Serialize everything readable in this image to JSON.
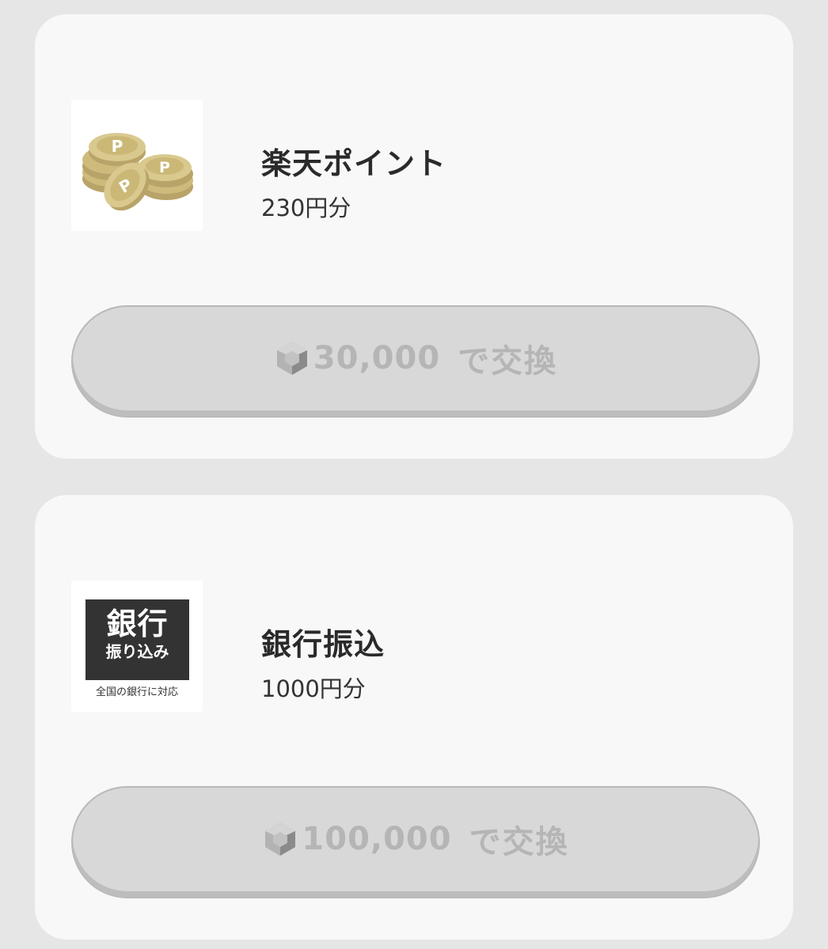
{
  "rewards": [
    {
      "title": "楽天ポイント",
      "amount": "230円分",
      "button": {
        "cost": "30,000",
        "suffix": "で交換"
      }
    },
    {
      "title": "銀行振込",
      "amount": "1000円分",
      "logo": {
        "main": "銀行",
        "sub": "振り込み",
        "note": "全国の銀行に対応"
      },
      "button": {
        "cost": "100,000",
        "suffix": "で交換"
      }
    }
  ],
  "icons": {
    "reward_1": "rakuten-point-coins-icon",
    "reward_2": "bank-transfer-logo",
    "currency": "gem-icon"
  },
  "colors": {
    "page_background": "#e6e6e6",
    "card_background": "#f8f8f8",
    "button_disabled_background": "#d8d8d8",
    "button_disabled_text": "#b5b5b5",
    "coin_gold": "#d6c486",
    "bank_logo_background": "#333333"
  }
}
